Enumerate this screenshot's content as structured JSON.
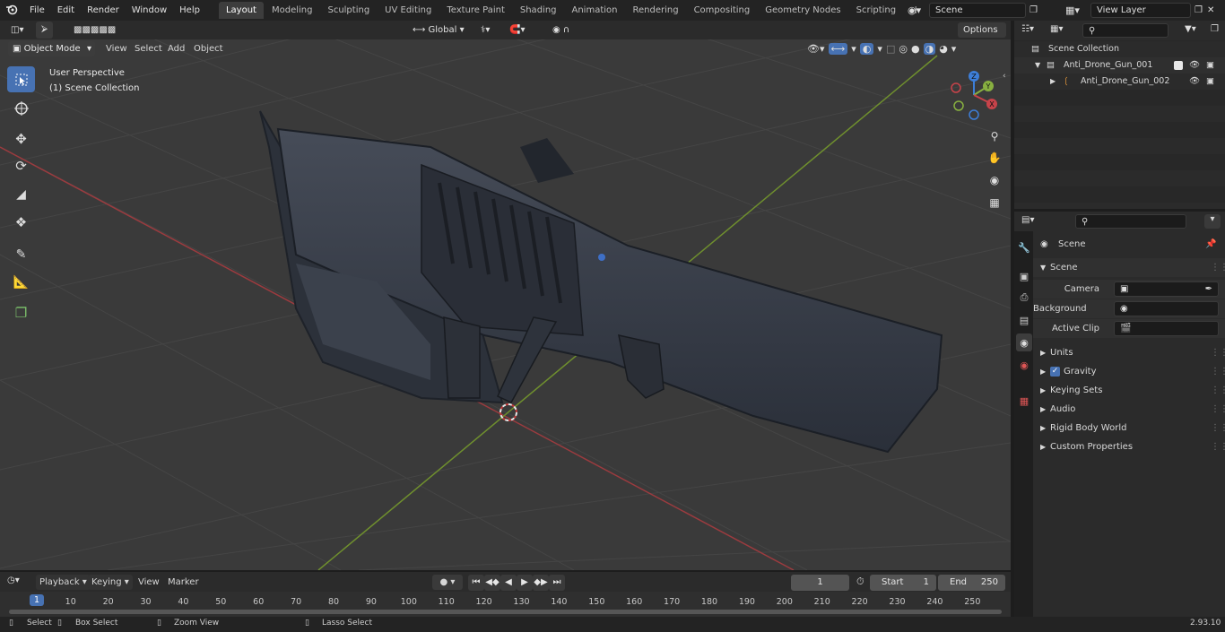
{
  "topbar": {
    "menus": [
      "File",
      "Edit",
      "Render",
      "Window",
      "Help"
    ],
    "workspaces": [
      "Layout",
      "Modeling",
      "Sculpting",
      "UV Editing",
      "Texture Paint",
      "Shading",
      "Animation",
      "Rendering",
      "Compositing",
      "Geometry Nodes",
      "Scripting"
    ],
    "active_workspace": "Layout",
    "scene_field": "Scene",
    "view_layer_field": "View Layer",
    "add_tab": "+"
  },
  "viewport_header": {
    "mode": "Object Mode",
    "menus": [
      "View",
      "Select",
      "Add",
      "Object"
    ],
    "transform_orientation": "Global",
    "options": "Options"
  },
  "viewport": {
    "overlay_title": "User Perspective",
    "overlay_collection": "(1) Scene Collection",
    "gizmo_axes": [
      "Z",
      "Y",
      "X"
    ]
  },
  "outliner": {
    "rows": [
      {
        "label": "Scene Collection"
      },
      {
        "label": "Anti_Drone_Gun_001"
      },
      {
        "label": "Anti_Drone_Gun_002"
      }
    ]
  },
  "properties": {
    "breadcrumb": "Scene",
    "panel_title": "Scene",
    "fields": [
      {
        "label": "Camera",
        "value": ""
      },
      {
        "label": "Background Scene",
        "value": ""
      },
      {
        "label": "Active Clip",
        "value": ""
      }
    ],
    "subpanels": [
      "Units",
      "Gravity",
      "Keying Sets",
      "Audio",
      "Rigid Body World",
      "Custom Properties"
    ],
    "gravity_checked": true
  },
  "timeline": {
    "menus": [
      "Playback",
      "Keying",
      "View",
      "Marker"
    ],
    "current_frame": "1",
    "start_label": "Start",
    "start_value": "1",
    "end_label": "End",
    "end_value": "250",
    "ruler": [
      "1",
      "10",
      "20",
      "30",
      "40",
      "50",
      "60",
      "70",
      "80",
      "90",
      "100",
      "110",
      "120",
      "130",
      "140",
      "150",
      "160",
      "170",
      "180",
      "190",
      "200",
      "210",
      "220",
      "230",
      "240",
      "250"
    ]
  },
  "statusbar": {
    "select": "Select",
    "box_select": "Box Select",
    "zoom_view": "Zoom View",
    "lasso_select": "Lasso Select",
    "version": "2.93.10"
  },
  "colors": {
    "accent": "#4772b3",
    "x_axis": "#c7434a",
    "y_axis": "#88b040",
    "z_axis": "#3d7ed8"
  }
}
